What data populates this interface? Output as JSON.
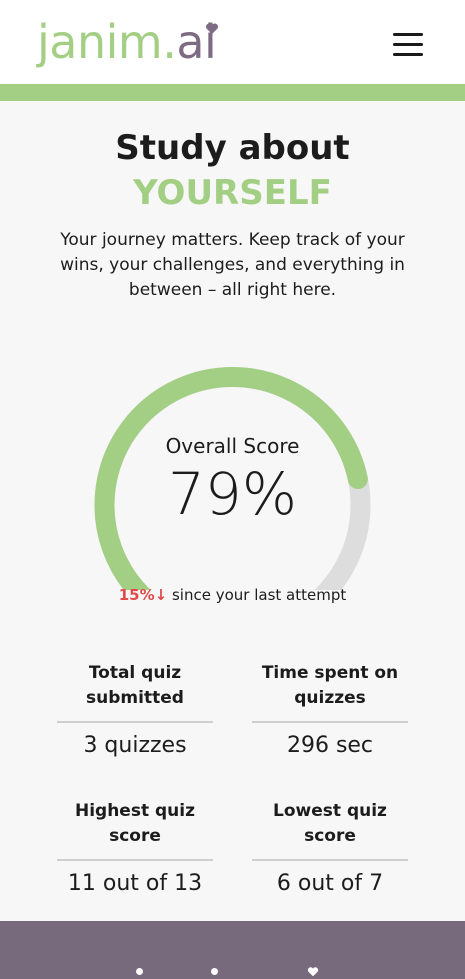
{
  "header": {
    "logo_part1": "janim",
    "logo_dot": ".",
    "logo_part2": "ai",
    "menu_icon": "hamburger-menu-icon"
  },
  "hero": {
    "title_line1": "Study about",
    "title_line2": "YOURSELF",
    "intro": "Your journey matters. Keep track of your wins, your challenges, and everything in between – all right here."
  },
  "score": {
    "label": "Overall Score",
    "value_text": "79%",
    "value": 0.79,
    "delta_pct": "15%",
    "delta_arrow": "↓",
    "delta_text": " since your last attempt"
  },
  "stats": [
    {
      "label": "Total quiz submitted",
      "value": "3 quizzes"
    },
    {
      "label": "Time spent on quizzes",
      "value": "296 sec"
    },
    {
      "label": "Highest quiz score",
      "value": "11 out of 13"
    },
    {
      "label": "Lowest quiz score",
      "value": "6 out of 7"
    }
  ],
  "colors": {
    "accent_green": "#a3cf84",
    "logo_purple": "#7d6b83",
    "footer": "#766a7c",
    "delta_red": "#e24b4b",
    "track_gray": "#dddddd"
  }
}
